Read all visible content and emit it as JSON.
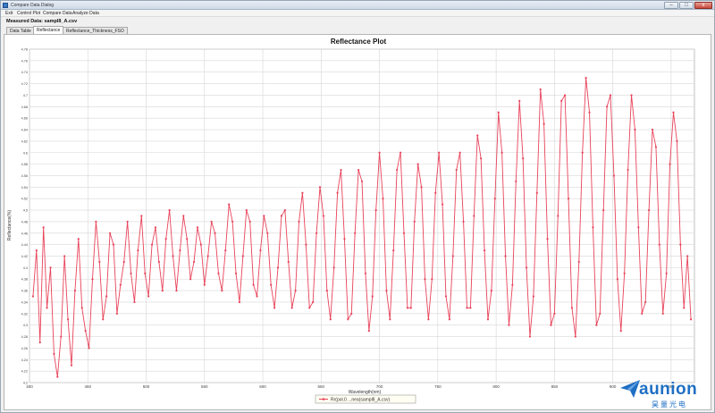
{
  "window": {
    "title": "Compare Data Dialog",
    "minimize_label": "–",
    "maximize_label": "□",
    "close_label": "x"
  },
  "menu": {
    "items": [
      "Exit",
      "Control Plot",
      "Compare Data",
      "Analyze Data"
    ]
  },
  "measured": "Measured Data: sampl8_A.csv",
  "tabs": [
    {
      "label": "Data Table",
      "active": false
    },
    {
      "label": "Reflectance",
      "active": true
    },
    {
      "label": "Reflectance_Thickness_FSO",
      "active": false
    }
  ],
  "colors": {
    "series": "#e8435a",
    "grid": "#d7d7d7",
    "accent": "#1f6fc4"
  },
  "watermark": {
    "brand": "aunion",
    "sub": "昊量光电",
    "icon": "paper-plane-logo"
  },
  "chart_data": {
    "type": "line",
    "title": "Reflectance Plot",
    "xlabel": "Wavelength(nm)",
    "ylabel": "Reflectance(%)",
    "xlim": [
      400,
      970
    ],
    "ylim": [
      4.2,
      4.78
    ],
    "x_ticks": [
      400,
      450,
      500,
      550,
      600,
      650,
      700,
      750,
      800,
      850,
      900,
      950
    ],
    "x_tick_labels": [
      "400",
      "450",
      "500",
      "550",
      "600",
      "650",
      "700",
      "750",
      "800",
      "850",
      "900",
      "950"
    ],
    "y_ticks": [
      4.2,
      4.22,
      4.24,
      4.26,
      4.28,
      4.3,
      4.32,
      4.34,
      4.36,
      4.38,
      4.4,
      4.42,
      4.44,
      4.46,
      4.48,
      4.5,
      4.52,
      4.54,
      4.56,
      4.58,
      4.6,
      4.62,
      4.64,
      4.66,
      4.68,
      4.7,
      4.72,
      4.74,
      4.76,
      4.78
    ],
    "y_tick_labels": [
      "4.2",
      "4.22",
      "4.24",
      "4.26",
      "4.28",
      "4.3",
      "4.32",
      "4.34",
      "4.36",
      "4.38",
      "4.4",
      "4.42",
      "4.44",
      "4.46",
      "4.48",
      "4.5",
      "4.52",
      "4.54",
      "4.56",
      "4.58",
      "4.6",
      "4.62",
      "4.64",
      "4.66",
      "4.68",
      "4.7",
      "4.72",
      "4.74",
      "4.76",
      "4.78"
    ],
    "legend": "top-center",
    "grid": true,
    "series": [
      {
        "name": "Rr(pol.0 ...nea(sampl8_A.csv)",
        "x": [
          403,
          406,
          409,
          412,
          415,
          418,
          421,
          424,
          427,
          430,
          433,
          436,
          439,
          442,
          445,
          448,
          451,
          454,
          457,
          460,
          463,
          466,
          469,
          472,
          475,
          478,
          481,
          484,
          487,
          490,
          493,
          496,
          499,
          502,
          505,
          508,
          511,
          514,
          517,
          520,
          523,
          526,
          529,
          532,
          535,
          538,
          541,
          544,
          547,
          550,
          553,
          556,
          559,
          562,
          565,
          568,
          571,
          574,
          577,
          580,
          583,
          586,
          589,
          592,
          595,
          598,
          601,
          604,
          607,
          610,
          613,
          616,
          619,
          622,
          625,
          628,
          631,
          634,
          637,
          640,
          643,
          646,
          649,
          652,
          655,
          658,
          661,
          664,
          667,
          670,
          673,
          676,
          679,
          682,
          685,
          688,
          691,
          694,
          697,
          700,
          703,
          706,
          709,
          712,
          715,
          718,
          721,
          724,
          727,
          730,
          733,
          736,
          739,
          742,
          745,
          748,
          751,
          754,
          757,
          760,
          763,
          766,
          769,
          772,
          775,
          778,
          781,
          784,
          787,
          790,
          793,
          796,
          799,
          802,
          805,
          808,
          811,
          814,
          817,
          820,
          823,
          826,
          829,
          832,
          835,
          838,
          841,
          844,
          847,
          850,
          853,
          856,
          859,
          862,
          865,
          868,
          871,
          874,
          877,
          880,
          883,
          886,
          889,
          892,
          895,
          898,
          901,
          904,
          907,
          910,
          913,
          916,
          919,
          922,
          925,
          928,
          931,
          934,
          937,
          940,
          943,
          946,
          949,
          952,
          955,
          958,
          961,
          964,
          967
        ],
        "y": [
          4.35,
          4.43,
          4.27,
          4.47,
          4.33,
          4.4,
          4.25,
          4.21,
          4.28,
          4.42,
          4.31,
          4.23,
          4.36,
          4.45,
          4.33,
          4.29,
          4.26,
          4.38,
          4.48,
          4.41,
          4.31,
          4.35,
          4.46,
          4.44,
          4.32,
          4.37,
          4.41,
          4.48,
          4.39,
          4.34,
          4.43,
          4.49,
          4.39,
          4.35,
          4.44,
          4.47,
          4.41,
          4.36,
          4.45,
          4.5,
          4.42,
          4.36,
          4.43,
          4.49,
          4.45,
          4.38,
          4.41,
          4.47,
          4.44,
          4.37,
          4.42,
          4.48,
          4.46,
          4.39,
          4.36,
          4.43,
          4.51,
          4.48,
          4.39,
          4.34,
          4.42,
          4.5,
          4.48,
          4.37,
          4.35,
          4.43,
          4.49,
          4.46,
          4.37,
          4.33,
          4.4,
          4.49,
          4.5,
          4.41,
          4.33,
          4.36,
          4.48,
          4.53,
          4.44,
          4.33,
          4.34,
          4.46,
          4.54,
          4.49,
          4.36,
          4.31,
          4.4,
          4.53,
          4.57,
          4.45,
          4.31,
          4.32,
          4.46,
          4.57,
          4.55,
          4.39,
          4.29,
          4.35,
          4.5,
          4.6,
          4.52,
          4.36,
          4.31,
          4.43,
          4.57,
          4.6,
          4.46,
          4.33,
          4.33,
          4.48,
          4.58,
          4.54,
          4.38,
          4.31,
          4.38,
          4.53,
          4.6,
          4.51,
          4.35,
          4.31,
          4.42,
          4.57,
          4.6,
          4.48,
          4.33,
          4.33,
          4.49,
          4.63,
          4.59,
          4.43,
          4.31,
          4.36,
          4.52,
          4.67,
          4.6,
          4.42,
          4.3,
          4.37,
          4.55,
          4.69,
          4.59,
          4.4,
          4.28,
          4.35,
          4.53,
          4.71,
          4.65,
          4.45,
          4.3,
          4.32,
          4.49,
          4.69,
          4.7,
          4.52,
          4.33,
          4.28,
          4.41,
          4.6,
          4.73,
          4.67,
          4.47,
          4.3,
          4.32,
          4.5,
          4.68,
          4.7,
          4.56,
          4.38,
          4.29,
          4.39,
          4.57,
          4.7,
          4.64,
          4.47,
          4.32,
          4.34,
          4.5,
          4.64,
          4.61,
          4.44,
          4.32,
          4.39,
          4.58,
          4.67,
          4.62,
          4.44,
          4.33,
          4.42,
          4.31
        ]
      }
    ]
  }
}
